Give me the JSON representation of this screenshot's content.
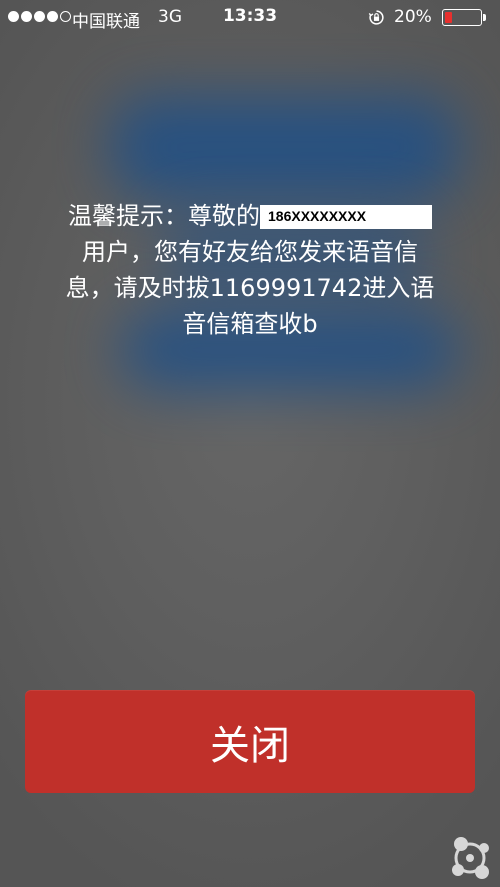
{
  "status_bar": {
    "carrier": "中国联通",
    "network": "3G",
    "time": "13:33",
    "battery_percent_label": "20%",
    "battery_level": 0.2,
    "signal_strength": 4,
    "signal_max": 5,
    "icons": [
      "orientation-lock-icon",
      "battery-icon"
    ]
  },
  "dialog": {
    "message_line1": "温馨提示：尊敬的",
    "phone_number": "186XXXXXXXX",
    "message_line2": "用户，您有好友给您发来语音信",
    "message_line3": "息，请及时拔1169991742进入语",
    "message_line4": "音信箱查收b",
    "close_label": "关闭"
  },
  "colors": {
    "background": "#5f5f5f",
    "accent_blur": "#1f4f86",
    "close_button": "#c0302a",
    "battery_low": "#e8302e"
  }
}
